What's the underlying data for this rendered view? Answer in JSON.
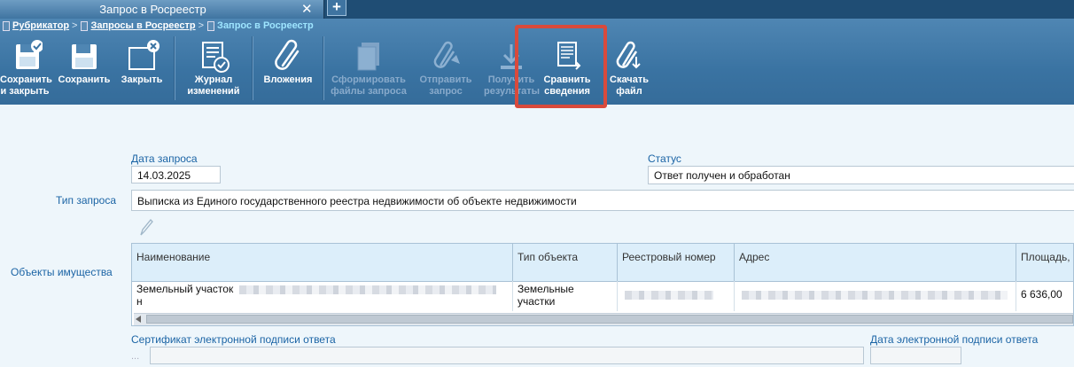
{
  "tab": {
    "title": "Запрос в Росреестр",
    "close": "✕",
    "add": "+"
  },
  "breadcrumb": {
    "items": [
      "Рубрикатор",
      "Запросы в Росреестр",
      "Запрос в Росреестр"
    ],
    "separator": ">"
  },
  "toolbar": {
    "save_close": {
      "line1": "Сохранить",
      "line2": "и закрыть"
    },
    "save": {
      "line1": "Сохранить"
    },
    "close": {
      "line1": "Закрыть"
    },
    "journal": {
      "line1": "Журнал",
      "line2": "изменений"
    },
    "attachments": {
      "line1": "Вложения"
    },
    "form_files": {
      "line1": "Сформировать",
      "line2": "файлы запроса"
    },
    "send": {
      "line1": "Отправить",
      "line2": "запрос"
    },
    "get_results": {
      "line1": "Получить",
      "line2": "результаты"
    },
    "compare": {
      "line1": "Сравнить",
      "line2": "сведения"
    },
    "download": {
      "line1": "Скачать",
      "line2": "файл"
    }
  },
  "form": {
    "date_label": "Дата запроса",
    "date_value": "14.03.2025",
    "status_label": "Статус",
    "status_value": "Ответ получен и обработан",
    "type_label": "Тип запроса",
    "type_value": "Выписка из Единого государственного реестра недвижимости об объекте недвижимости",
    "objects_label": "Объекты имущества",
    "cert_label": "Сертификат электронной подписи ответа",
    "cert_dots": "...",
    "sign_date_label": "Дата электронной подписи ответа"
  },
  "grid": {
    "columns": [
      "Наименование",
      "Тип объекта",
      "Реестровый номер",
      "Адрес",
      "Площадь,"
    ],
    "rows": [
      {
        "name_prefix": "Земельный участок ",
        "name_suffix": "н",
        "type_line1": "Земельные",
        "type_line2": "участки",
        "area": "6 636,00"
      }
    ]
  },
  "colors": {
    "accent": "#1b64a5",
    "toolbar": "#3a73a2",
    "highlight": "#d94a3c"
  }
}
